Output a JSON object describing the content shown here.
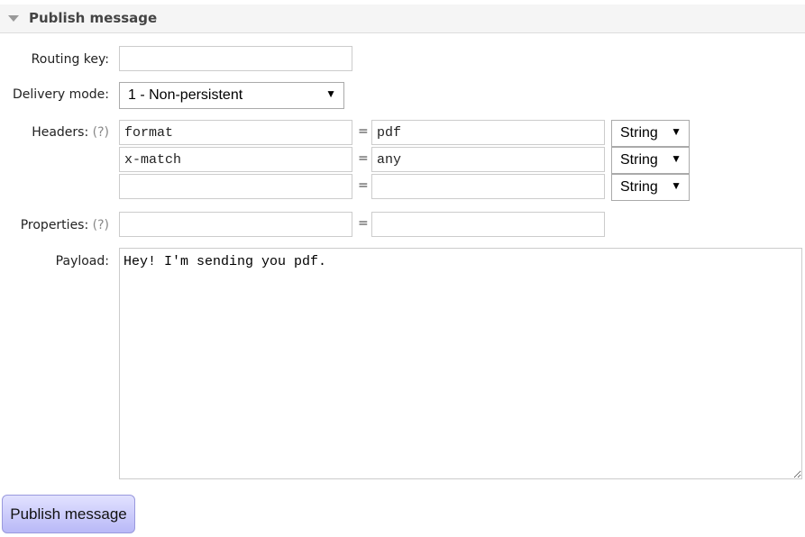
{
  "section": {
    "title": "Publish message"
  },
  "form": {
    "routing_key": {
      "label": "Routing key:",
      "value": ""
    },
    "delivery_mode": {
      "label": "Delivery mode:",
      "value": "1 - Non-persistent"
    },
    "headers": {
      "label": "Headers:",
      "help": "(?)",
      "rows": [
        {
          "key": "format",
          "value": "pdf",
          "type": "String"
        },
        {
          "key": "x-match",
          "value": "any",
          "type": "String"
        },
        {
          "key": "",
          "value": "",
          "type": "String"
        }
      ]
    },
    "properties": {
      "label": "Properties:",
      "help": "(?)",
      "key": "",
      "value": ""
    },
    "payload": {
      "label": "Payload:",
      "value": "Hey! I'm sending you pdf."
    },
    "equals": "="
  },
  "button": {
    "label": "Publish message"
  }
}
